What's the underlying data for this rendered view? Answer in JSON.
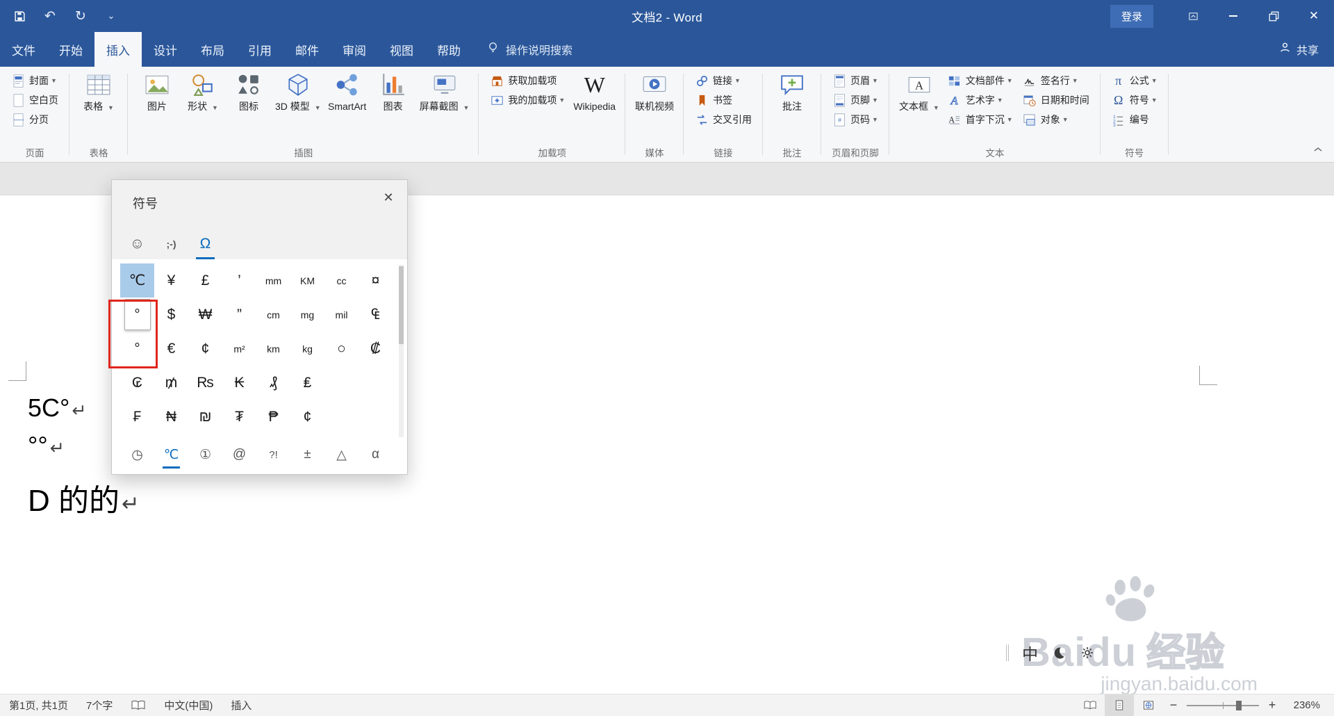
{
  "titlebar": {
    "title": "文档2 - Word",
    "sign_in": "登录"
  },
  "ribbon": {
    "tabs": [
      {
        "name": "file",
        "label": "文件"
      },
      {
        "name": "home",
        "label": "开始"
      },
      {
        "name": "insert",
        "label": "插入"
      },
      {
        "name": "design",
        "label": "设计"
      },
      {
        "name": "layout",
        "label": "布局"
      },
      {
        "name": "references",
        "label": "引用"
      },
      {
        "name": "mailings",
        "label": "邮件"
      },
      {
        "name": "review",
        "label": "审阅"
      },
      {
        "name": "view",
        "label": "视图"
      },
      {
        "name": "help",
        "label": "帮助"
      }
    ],
    "active_tab": "insert",
    "tell_me": "操作说明搜索",
    "share": "共享",
    "groups": [
      {
        "name": "pages",
        "label": "页面",
        "columns": [
          {
            "type": "stack",
            "items": [
              {
                "name": "cover-page",
                "label": "封面",
                "icon": "cover",
                "dd": true
              },
              {
                "name": "blank-page",
                "label": "空白页",
                "icon": "blank"
              },
              {
                "name": "page-break",
                "label": "分页",
                "icon": "pbreak"
              }
            ]
          }
        ]
      },
      {
        "name": "tables",
        "label": "表格",
        "columns": [
          {
            "type": "large",
            "items": [
              {
                "name": "table",
                "label": "表格",
                "icon": "table",
                "dd": true
              }
            ]
          }
        ]
      },
      {
        "name": "illustrations",
        "label": "插图",
        "columns": [
          {
            "type": "large",
            "items": [
              {
                "name": "pictures",
                "label": "图片",
                "icon": "picture"
              }
            ]
          },
          {
            "type": "large",
            "items": [
              {
                "name": "shapes",
                "label": "形状",
                "icon": "shapes",
                "dd": true
              }
            ]
          },
          {
            "type": "large",
            "items": [
              {
                "name": "icons",
                "label": "图标",
                "icon": "icons"
              }
            ]
          },
          {
            "type": "large",
            "items": [
              {
                "name": "3d-models",
                "label": "3D 模型",
                "icon": "cube",
                "dd": true
              }
            ]
          },
          {
            "type": "large",
            "items": [
              {
                "name": "smartart",
                "label": "SmartArt",
                "icon": "smartart"
              }
            ]
          },
          {
            "type": "large",
            "items": [
              {
                "name": "chart",
                "label": "图表",
                "icon": "chart"
              }
            ]
          },
          {
            "type": "large",
            "items": [
              {
                "name": "screenshot",
                "label": "屏幕截图",
                "icon": "screenshot",
                "dd": true
              }
            ]
          }
        ]
      },
      {
        "name": "add-ins",
        "label": "加载项",
        "columns": [
          {
            "type": "stack",
            "items": [
              {
                "name": "get-add-ins",
                "label": "获取加载项",
                "icon": "store"
              },
              {
                "name": "my-add-ins",
                "label": "我的加载项",
                "icon": "myaddin",
                "dd": true
              }
            ]
          },
          {
            "type": "large",
            "items": [
              {
                "name": "wikipedia",
                "label": "Wikipedia",
                "icon": "wikipedia"
              }
            ]
          }
        ]
      },
      {
        "name": "media",
        "label": "媒体",
        "columns": [
          {
            "type": "large",
            "items": [
              {
                "name": "online-video",
                "label": "联机视频",
                "icon": "video"
              }
            ]
          }
        ]
      },
      {
        "name": "links",
        "label": "链接",
        "columns": [
          {
            "type": "stack",
            "items": [
              {
                "name": "link",
                "label": "链接",
                "icon": "link",
                "dd": true
              },
              {
                "name": "bookmark",
                "label": "书签",
                "icon": "bookmark"
              },
              {
                "name": "cross-reference",
                "label": "交叉引用",
                "icon": "crossref"
              }
            ]
          }
        ]
      },
      {
        "name": "comments",
        "label": "批注",
        "columns": [
          {
            "type": "large",
            "items": [
              {
                "name": "comment",
                "label": "批注",
                "icon": "comment"
              }
            ]
          }
        ]
      },
      {
        "name": "header-footer",
        "label": "页眉和页脚",
        "columns": [
          {
            "type": "stack",
            "items": [
              {
                "name": "header",
                "label": "页眉",
                "icon": "header",
                "dd": true
              },
              {
                "name": "footer",
                "label": "页脚",
                "icon": "footer",
                "dd": true
              },
              {
                "name": "page-number",
                "label": "页码",
                "icon": "pagenum",
                "dd": true
              }
            ]
          }
        ]
      },
      {
        "name": "text",
        "label": "文本",
        "columns": [
          {
            "type": "large",
            "items": [
              {
                "name": "text-box",
                "label": "文本框",
                "icon": "textbox",
                "dd": true
              }
            ]
          },
          {
            "type": "stack",
            "items": [
              {
                "name": "quick-parts",
                "label": "文档部件",
                "icon": "quickparts",
                "dd": true
              },
              {
                "name": "wordart",
                "label": "艺术字",
                "icon": "wordart",
                "dd": true
              },
              {
                "name": "drop-cap",
                "label": "首字下沉",
                "icon": "dropcap",
                "dd": true
              }
            ]
          },
          {
            "type": "stack",
            "items": [
              {
                "name": "signature-line",
                "label": "签名行",
                "icon": "signature",
                "dd": true
              },
              {
                "name": "date-time",
                "label": "日期和时间",
                "icon": "datetime"
              },
              {
                "name": "object",
                "label": "对象",
                "icon": "object",
                "dd": true
              }
            ]
          }
        ]
      },
      {
        "name": "symbols",
        "label": "符号",
        "columns": [
          {
            "type": "stack",
            "items": [
              {
                "name": "equation",
                "label": "公式",
                "icon": "pi",
                "dd": true
              },
              {
                "name": "symbol",
                "label": "符号",
                "icon": "omega",
                "dd": true
              },
              {
                "name": "numbering",
                "label": "编号",
                "icon": "numbering"
              }
            ]
          }
        ]
      }
    ]
  },
  "symbol_panel": {
    "title": "符号",
    "close": "✕",
    "tabs": [
      {
        "name": "emoji",
        "glyph": "☺"
      },
      {
        "name": "kaomoji",
        "glyph": ";-)"
      },
      {
        "name": "symbols",
        "glyph": "Ω",
        "selected": true
      }
    ],
    "grid": [
      [
        "℃",
        "¥",
        "£",
        "’",
        "mm",
        "KM",
        "cc",
        "¤"
      ],
      [
        "°",
        "$",
        "₩",
        "”",
        "cm",
        "mg",
        "mil",
        "₠"
      ],
      [
        "°",
        "€",
        "¢",
        "m²",
        "km",
        "kg",
        "○",
        "₡"
      ],
      [
        "₢",
        "₥",
        "₨",
        "₭",
        "₰",
        "₤",
        "",
        ""
      ],
      [
        "₣",
        "₦",
        "₪",
        "₮",
        "₱",
        "¢",
        "",
        ""
      ]
    ],
    "selected_cell": {
      "row": 0,
      "col": 0
    },
    "keyed_cell": {
      "row": 1,
      "col": 0
    },
    "categories": [
      {
        "name": "recent",
        "glyph": "◷"
      },
      {
        "name": "units-currency",
        "glyph": "℃",
        "selected": true
      },
      {
        "name": "enclosed-numbers",
        "glyph": "①"
      },
      {
        "name": "at-symbols",
        "glyph": "@"
      },
      {
        "name": "punctuation",
        "glyph": "?!"
      },
      {
        "name": "math",
        "glyph": "±"
      },
      {
        "name": "geometric-shapes",
        "glyph": "△"
      },
      {
        "name": "greek-letters",
        "glyph": "α"
      }
    ]
  },
  "document": {
    "lines": [
      "5C°",
      "°°",
      "D 的的"
    ],
    "return_mark": "↵"
  },
  "ime": {
    "language": "中"
  },
  "watermark": {
    "brand": "Baidu",
    "suffix": "经验",
    "url": "jingyan.baidu.com"
  },
  "status": {
    "page": "第1页, 共1页",
    "words": "7个字",
    "language": "中文(中国)",
    "mode": "插入",
    "zoom": "236%",
    "zoom_out": "−",
    "zoom_in": "+"
  }
}
